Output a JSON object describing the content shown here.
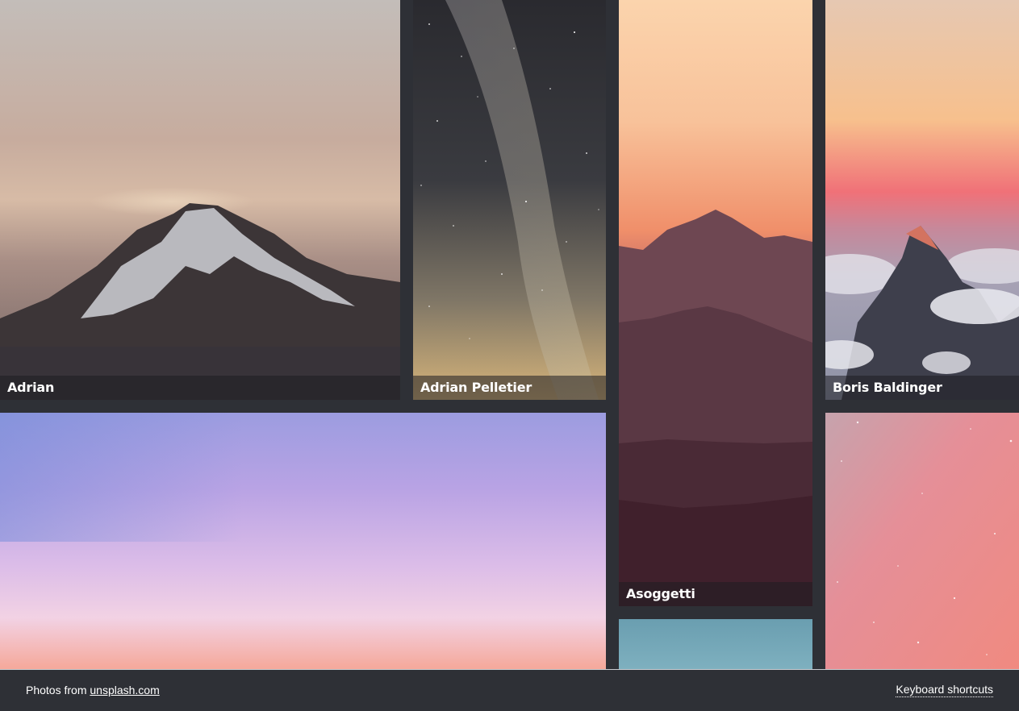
{
  "photos": [
    {
      "id": "adrian",
      "author": "Adrian"
    },
    {
      "id": "pelletier",
      "author": "Adrian Pelletier"
    },
    {
      "id": "asoggetti",
      "author": "Asoggetti"
    },
    {
      "id": "boris",
      "author": "Boris Baldinger"
    }
  ],
  "footer": {
    "credit_prefix": "Photos from ",
    "credit_link": "unsplash.com",
    "shortcuts_label": "Keyboard shortcuts"
  },
  "colors": {
    "background": "#2e3036",
    "caption_bg": "rgba(30,30,34,0.55)"
  }
}
